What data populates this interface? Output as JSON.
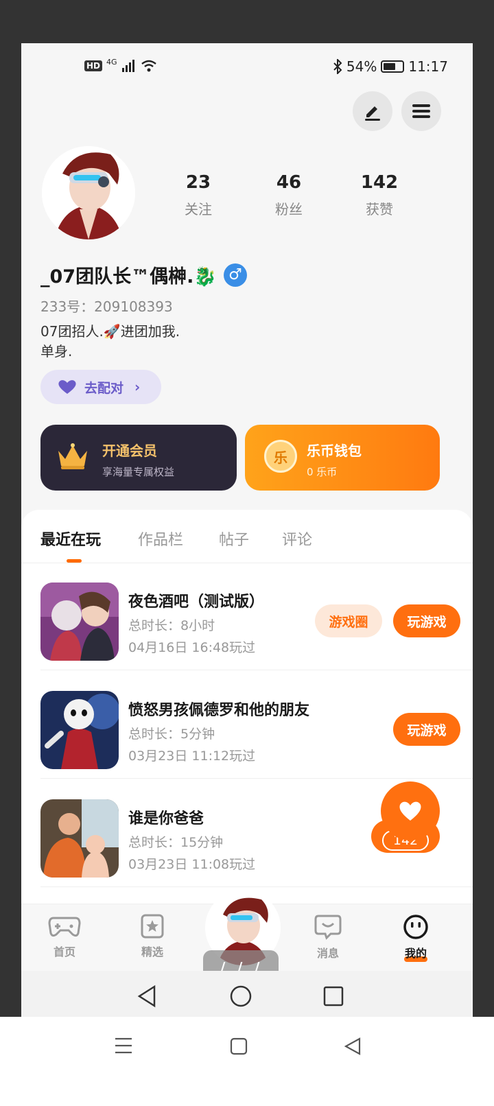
{
  "status_bar": {
    "network": "4G",
    "battery": "54%",
    "time": "11:17"
  },
  "stats": [
    {
      "value": "23",
      "label": "关注"
    },
    {
      "value": "46",
      "label": "粉丝"
    },
    {
      "value": "142",
      "label": "获赞"
    }
  ],
  "profile": {
    "username": "_07团队长™偶榊.🐉",
    "gender_symbol": "♂",
    "id_line": "233号：209108393",
    "bio": "07团招人.🚀进团加我.\n单身.",
    "match_label": "去配对"
  },
  "cards": {
    "vip_title": "开通会员",
    "vip_sub": "享海量专属权益",
    "wallet_icon_char": "乐",
    "wallet_title": "乐币钱包",
    "wallet_sub": "0 乐币"
  },
  "tabs": [
    "最近在玩",
    "作品栏",
    "帖子",
    "评论"
  ],
  "games": [
    {
      "title": "夜色酒吧（测试版）",
      "duration": "总时长：8小时",
      "last_played": "04月16日 16:48玩过",
      "circle_label": "游戏圈",
      "play_label": "玩游戏"
    },
    {
      "title": "愤怒男孩佩德罗和他的朋友",
      "duration": "总时长：5分钟",
      "last_played": "03月23日 11:12玩过",
      "play_label": "玩游戏"
    },
    {
      "title": "谁是你爸爸",
      "duration": "总时长：15分钟",
      "last_played": "03月23日 11:08玩过"
    }
  ],
  "like_count": "142",
  "bottom_nav": [
    {
      "label": "首页",
      "icon": "gamepad-icon"
    },
    {
      "label": "精选",
      "icon": "star-bookmark-icon"
    },
    {
      "label": "消息",
      "icon": "chat-bubble-icon"
    },
    {
      "label": "我的",
      "icon": "smiley-face-icon"
    }
  ],
  "overlay_text": "/ / /",
  "colors": {
    "accent": "#ff6f0f",
    "vip_bg": "#2b2738",
    "match_purple": "#6b5cc9",
    "gender_blue": "#3a8ee6"
  }
}
